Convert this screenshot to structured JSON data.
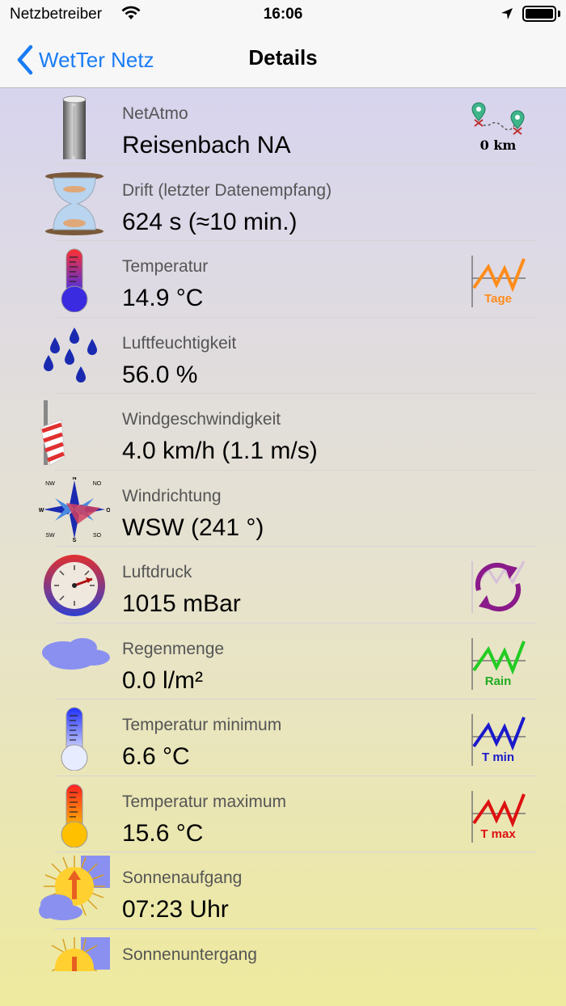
{
  "status_bar": {
    "carrier": "Netzbetreiber",
    "time": "16:06"
  },
  "nav": {
    "back_label": "WetTer Netz",
    "title": "Details"
  },
  "rows": [
    {
      "label": "NetAtmo",
      "value": "Reisenbach NA",
      "aux_text": "0 km"
    },
    {
      "label": "Drift (letzter Datenempfang)",
      "value": "624 s (≈10 min.)"
    },
    {
      "label": "Temperatur",
      "value": "14.9 °C",
      "aux_text": "Tage"
    },
    {
      "label": "Luftfeuchtigkeit",
      "value": "56.0 %"
    },
    {
      "label": "Windgeschwindigkeit",
      "value": "4.0  km/h (1.1 m/s)"
    },
    {
      "label": "Windrichtung",
      "value": "WSW (241 °)"
    },
    {
      "label": "Luftdruck",
      "value": "1015  mBar"
    },
    {
      "label": "Regenmenge",
      "value": "0.0 l/m²",
      "aux_text": "Rain"
    },
    {
      "label": "Temperatur minimum",
      "value": "6.6 °C",
      "aux_text": "T min"
    },
    {
      "label": "Temperatur maximum",
      "value": "15.6 °C",
      "aux_text": "T max"
    },
    {
      "label": "Sonnenaufgang",
      "value": "07:23 Uhr"
    },
    {
      "label": "Sonnenuntergang",
      "value": ""
    }
  ],
  "compass_labels": {
    "n": "N",
    "s": "S",
    "o": "O",
    "w": "W",
    "nw": "NW",
    "no": "NO",
    "sw": "SW",
    "so": "SO"
  },
  "colors": {
    "accent": "#1a7cf5",
    "chart_orange": "#ff8c1a",
    "chart_green": "#22cc22",
    "chart_blue": "#1a1acc",
    "chart_red": "#dd1111",
    "pressure_purple": "#8a1a8a"
  }
}
